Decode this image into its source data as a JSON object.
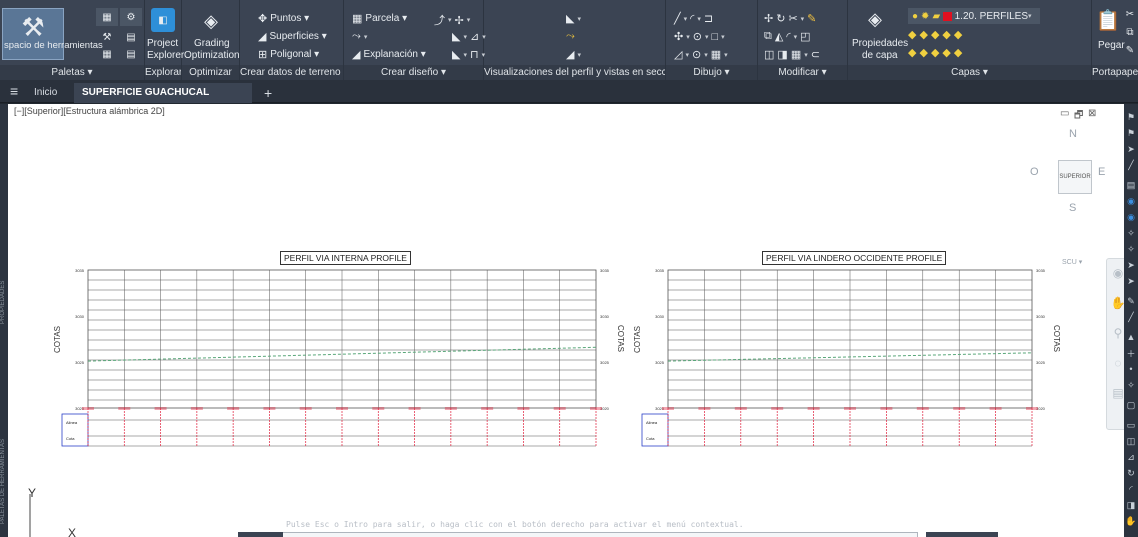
{
  "ribbon": {
    "groups": [
      {
        "footer": "Paletas ▾",
        "big_label": "spacio de herramientas"
      },
      {
        "footer": "Explorar",
        "big_label_1": "Project",
        "big_label_2": "Explorer"
      },
      {
        "footer": "Optimizar",
        "big_label_1": "Grading",
        "big_label_2": "Optimization"
      },
      {
        "footer": "Crear datos de terreno ▾",
        "items": [
          "Puntos ▾",
          "Superficies ▾",
          "Poligonal ▾"
        ]
      },
      {
        "footer": "Crear diseño ▾",
        "items": [
          "Parcela ▾",
          "",
          "Explanación ▾"
        ]
      },
      {
        "footer": "Visualizaciones del perfil y vistas en sección"
      },
      {
        "footer": "Dibujo ▾"
      },
      {
        "footer": "Modificar ▾"
      },
      {
        "footer": "Capas ▾",
        "big_label_1": "Propiedades",
        "big_label_2": "de capa",
        "layer_name": "1.20. PERFILES"
      },
      {
        "footer": "Portapapeles",
        "big_label": "Pegar"
      }
    ]
  },
  "tabs": {
    "menu_icon": "≡",
    "home": "Inicio",
    "active": "SUPERFICIE GUACHUCAL AUTOCAD*",
    "close": "×",
    "add": "+"
  },
  "viewport": {
    "label": "[−][Superior][Estructura alámbrica 2D]",
    "controls": [
      "▭",
      "🗗",
      "⊠"
    ]
  },
  "navcube": {
    "n": "N",
    "s": "S",
    "e": "E",
    "w": "O",
    "face": "SUPERIOR",
    "wcs": "SCU ▾"
  },
  "profiles": [
    {
      "title": "PERFIL VIA INTERNA PROFILE",
      "ylabel": "COTAS",
      "ticks": [
        "3035",
        "3030",
        "3025",
        "3020"
      ],
      "rows": [
        "Alinea",
        "Cota"
      ]
    },
    {
      "title": "PERFIL VIA LINDERO OCCIDENTE PROFILE",
      "ylabel": "COTAS",
      "ticks": [
        "3035",
        "3030",
        "3025",
        "3020"
      ],
      "rows": [
        "Alinea",
        "Cota"
      ]
    }
  ],
  "ucs": {
    "y": "Y",
    "x": "X"
  },
  "command_line": "Pulse Esc o Intro para salir, o haga clic con el botón derecho para activar el menú contextual.",
  "colors": {
    "ribbon": "#3b4453",
    "canvas": "#ffffff",
    "grid": "#555555",
    "profile_line": "#5aa77a",
    "data_box": "#2a3fc8",
    "station_marks": "#e0203c"
  }
}
